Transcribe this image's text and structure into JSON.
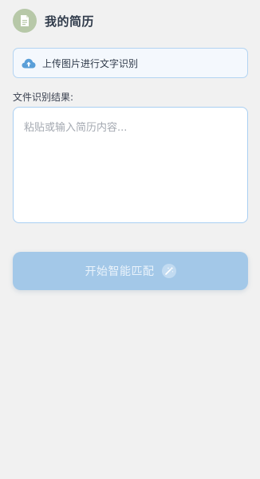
{
  "header": {
    "icon": "document-icon",
    "title": "我的简历",
    "icon_bg": "#b7c8a8"
  },
  "upload": {
    "icon": "cloud-upload-icon",
    "label": "上传图片进行文字识别"
  },
  "result": {
    "label": "文件识别结果:",
    "value": "",
    "placeholder": "粘贴或输入简历内容..."
  },
  "match_button": {
    "label": "开始智能匹配",
    "icon": "magic-wand-icon",
    "color": "#a3c8e8"
  },
  "colors": {
    "background": "#f1f1f1",
    "accent_border": "#a9cff2"
  }
}
